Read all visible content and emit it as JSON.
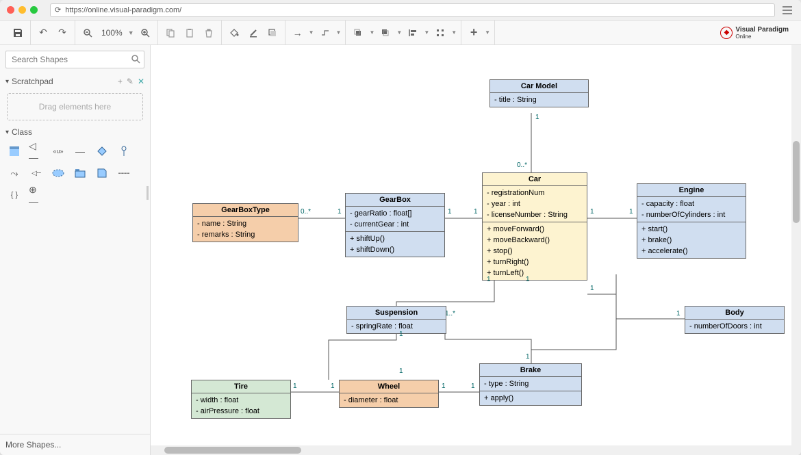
{
  "browser": {
    "url": "https://online.visual-paradigm.com/"
  },
  "toolbar": {
    "zoom": "100%"
  },
  "logo": {
    "name": "Visual Paradigm",
    "sub": "Online"
  },
  "sidebar": {
    "search_placeholder": "Search Shapes",
    "scratchpad_label": "Scratchpad",
    "dropzone_text": "Drag elements here",
    "class_label": "Class",
    "more_shapes": "More Shapes..."
  },
  "classes": {
    "carModel": {
      "name": "Car Model",
      "attrs": [
        "- title : String"
      ]
    },
    "gearBoxType": {
      "name": "GearBoxType",
      "attrs": [
        "- name : String",
        "- remarks : String"
      ]
    },
    "gearBox": {
      "name": "GearBox",
      "attrs": [
        "- gearRatio : float[]",
        "- currentGear : int"
      ],
      "ops": [
        "+ shiftUp()",
        "+ shiftDown()"
      ]
    },
    "car": {
      "name": "Car",
      "attrs": [
        "- registrationNum",
        "- year : int",
        "- licenseNumber : String"
      ],
      "ops": [
        "+ moveForward()",
        "+ moveBackward()",
        "+ stop()",
        "+ turnRight()",
        "+ turnLeft()"
      ]
    },
    "engine": {
      "name": "Engine",
      "attrs": [
        "- capacity : float",
        "- numberOfCylinders : int"
      ],
      "ops": [
        "+ start()",
        "+ brake()",
        "+ accelerate()"
      ]
    },
    "suspension": {
      "name": "Suspension",
      "attrs": [
        "- springRate : float"
      ]
    },
    "body": {
      "name": "Body",
      "attrs": [
        "- numberOfDoors : int"
      ]
    },
    "tire": {
      "name": "Tire",
      "attrs": [
        "- width : float",
        "- airPressure : float"
      ]
    },
    "wheel": {
      "name": "Wheel",
      "attrs": [
        "- diameter : float"
      ]
    },
    "brake": {
      "name": "Brake",
      "attrs": [
        "- type : String"
      ],
      "ops": [
        "+ apply()"
      ]
    }
  },
  "multiplicities": {
    "carModel_car_top": "1",
    "carModel_car_bottom": "0..*",
    "gearBoxType_gearBox_left": "0..*",
    "gearBoxType_gearBox_right": "1",
    "gearBox_car_left": "1",
    "gearBox_car_right": "1",
    "car_engine_left": "1",
    "car_engine_right": "1",
    "car_suspension_top": "1",
    "car_suspension_bottom": "1..*",
    "car_body_top": "1",
    "car_body_bottom": "1",
    "car_brake_top": "1",
    "car_brake_bottom": "1",
    "suspension_wheel_top": "1",
    "suspension_wheel_bottom": "1",
    "tire_wheel_left": "1",
    "tire_wheel_right": "1",
    "wheel_brake_left": "1",
    "wheel_brake_right": "1"
  }
}
